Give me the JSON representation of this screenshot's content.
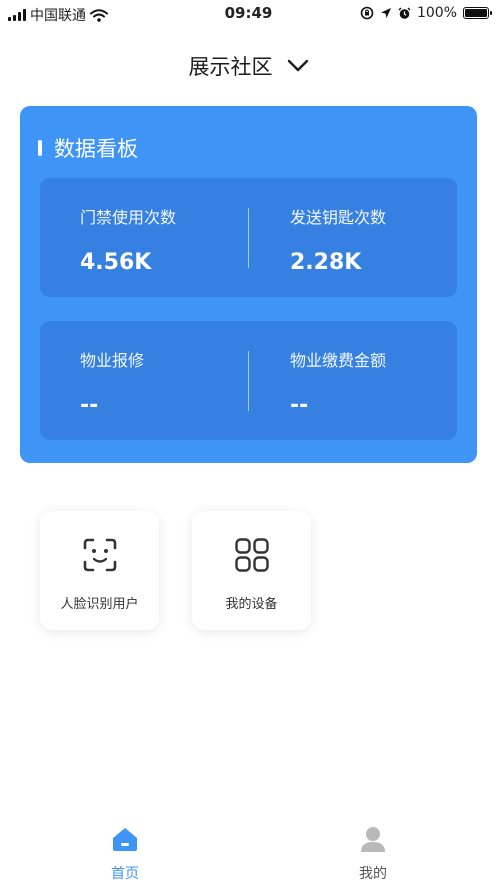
{
  "status_bar": {
    "carrier": "中国联通",
    "time": "09:49",
    "battery": "100%",
    "battery_level": 1.0
  },
  "header": {
    "title": "展示社区",
    "dropdown_icon": "chevron-down-icon"
  },
  "dashboard": {
    "title": "数据看板",
    "background_color": "#3e95f5",
    "stats": [
      {
        "label": "门禁使用次数",
        "value": "4.56K"
      },
      {
        "label": "发送钥匙次数",
        "value": "2.28K"
      },
      {
        "label": "物业报修",
        "value": "--"
      },
      {
        "label": "物业缴费金额",
        "value": "--"
      }
    ]
  },
  "shortcuts": [
    {
      "label": "人脸识别用户",
      "icon": "face-scan-icon"
    },
    {
      "label": "我的设备",
      "icon": "grid-icon"
    }
  ],
  "tabbar": {
    "active_color": "#3e95f5",
    "items": [
      {
        "label": "首页",
        "icon": "home-icon",
        "active": true
      },
      {
        "label": "我的",
        "icon": "user-icon",
        "active": false
      }
    ]
  }
}
